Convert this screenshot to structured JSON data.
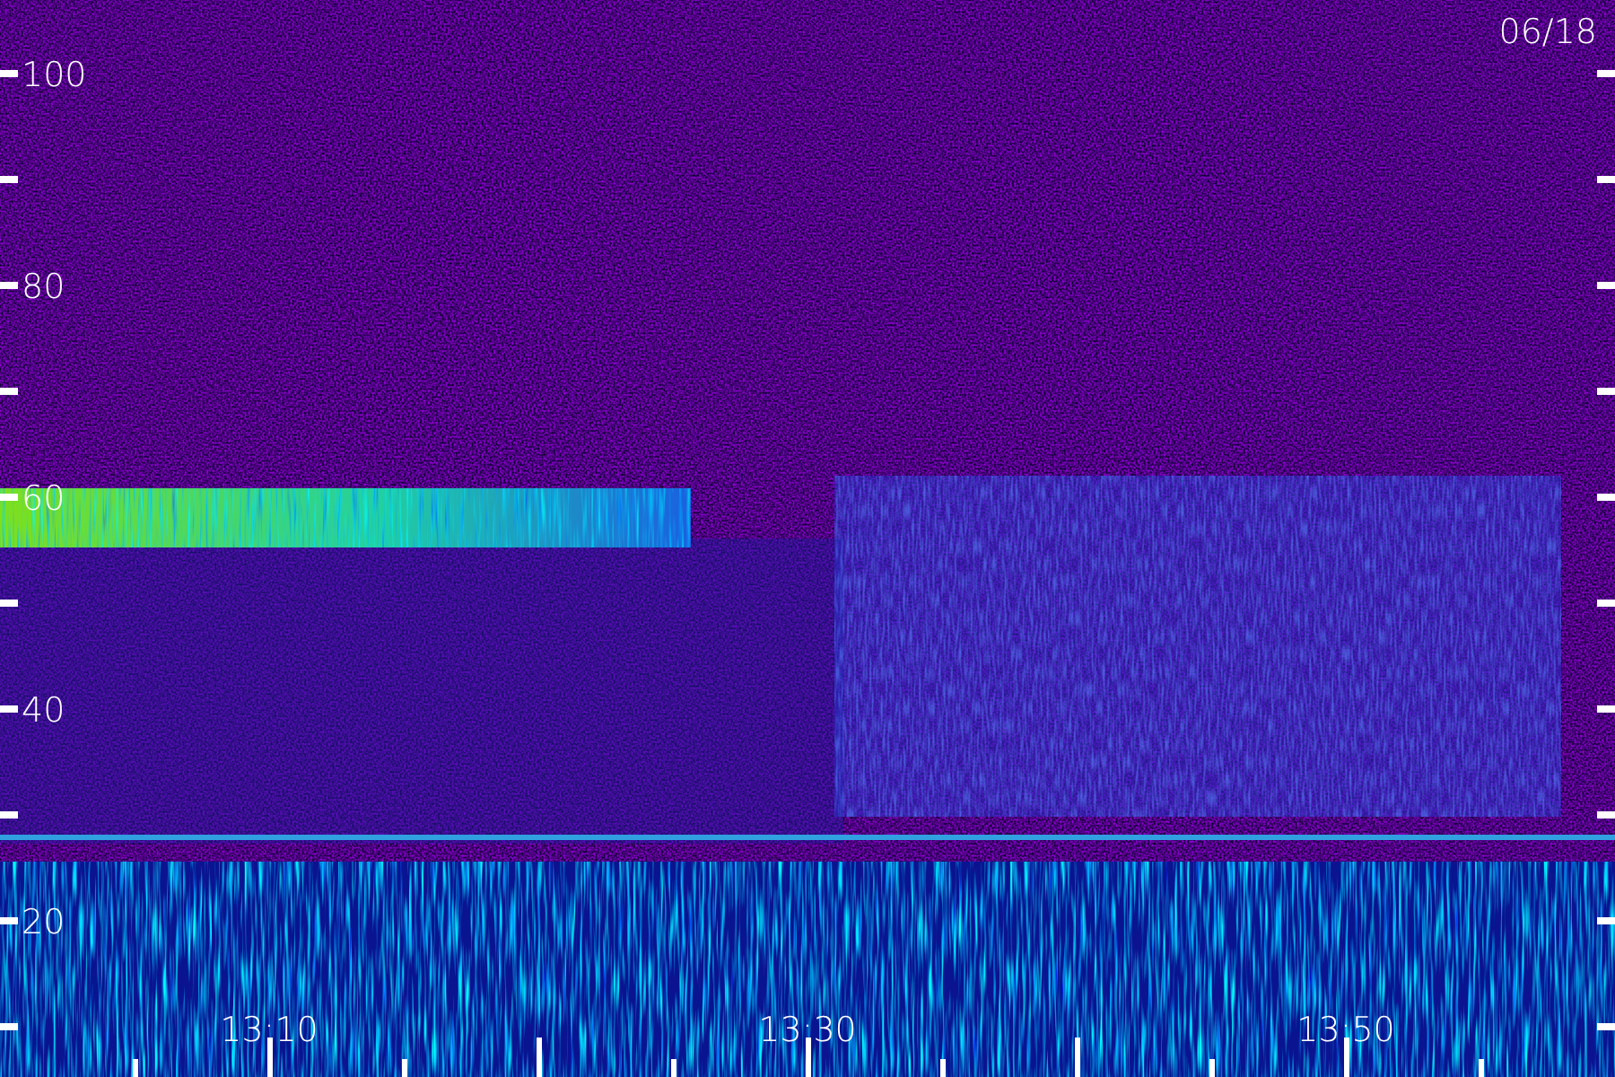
{
  "date": "06/18",
  "y_axis": {
    "labels": [
      "100",
      "80",
      "60",
      "40",
      "20"
    ]
  },
  "x_axis": {
    "labels": [
      "13:10",
      "13:30",
      "13:50"
    ]
  }
}
